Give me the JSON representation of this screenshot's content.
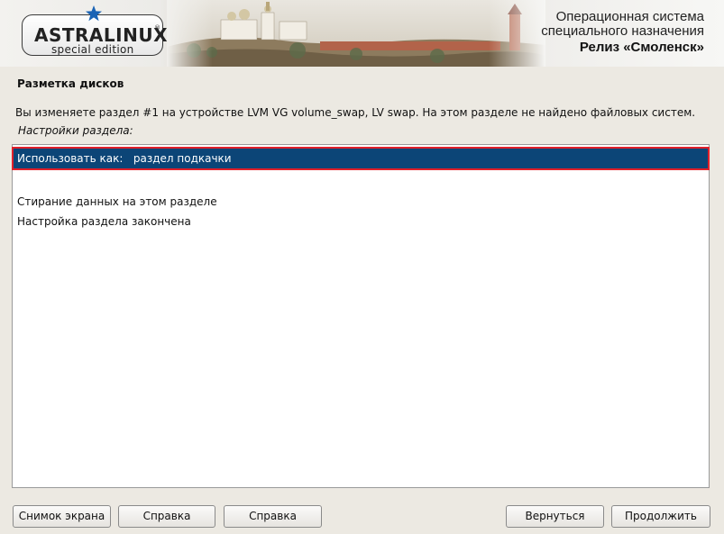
{
  "header": {
    "logo_name": "ASTRALINUX",
    "logo_reg": "®",
    "logo_subtitle": "special edition",
    "os_line1": "Операционная система",
    "os_line2": "специального назначения",
    "release": "Релиз «Смоленск»"
  },
  "main": {
    "section_title": "Разметка дисков",
    "description": "Вы изменяете раздел #1 на устройстве LVM VG volume_swap, LV swap. На этом разделе не найдено файловых систем.",
    "settings_label": "Настройки раздела:",
    "items": [
      {
        "label": "Использовать как:   раздел подкачки",
        "selected": true
      },
      {
        "label": "Стирание данных на этом разделе",
        "selected": false
      },
      {
        "label": "Настройка раздела закончена",
        "selected": false
      }
    ]
  },
  "buttons": {
    "screenshot": "Снимок экрана",
    "help1": "Справка",
    "help2": "Справка",
    "back": "Вернуться",
    "continue": "Продолжить"
  },
  "colors": {
    "selection": "#0c4577",
    "highlight_frame": "#e0202a",
    "background": "#ece9e2"
  }
}
